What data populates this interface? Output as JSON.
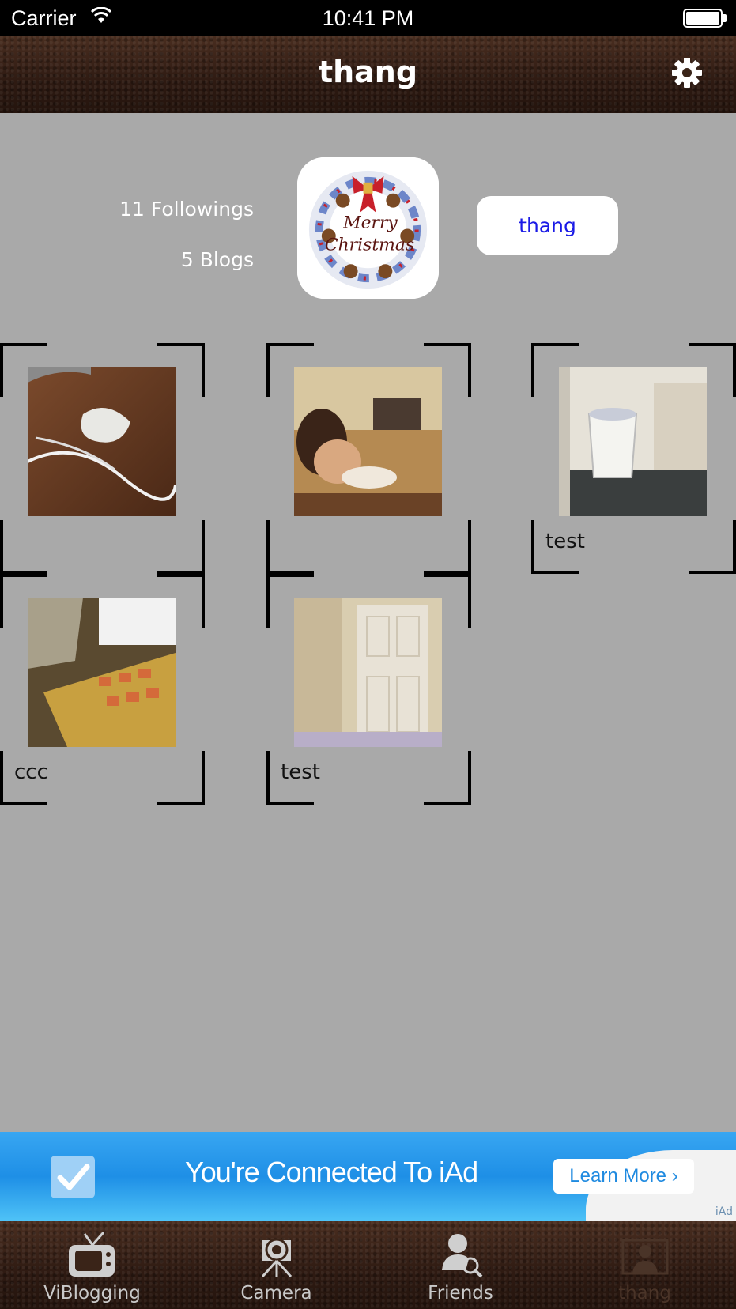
{
  "status_bar": {
    "carrier": "Carrier",
    "time": "10:41 PM"
  },
  "nav": {
    "title": "thang",
    "settings_icon": "gear-icon"
  },
  "profile": {
    "followings": "11 Followings",
    "blogs": "5 Blogs",
    "username_button": "thang",
    "avatar_image_text": "Merry Christmas"
  },
  "blogs": [
    {
      "caption": "",
      "thumb": "table-with-cables"
    },
    {
      "caption": "",
      "thumb": "person-cooking"
    },
    {
      "caption": "test",
      "thumb": "laundry-room"
    },
    {
      "caption": "ccc",
      "thumb": "laptop-keyboard"
    },
    {
      "caption": "test",
      "thumb": "white-door"
    }
  ],
  "ad": {
    "headline": "You're Connected To iAd",
    "button": "Learn More",
    "button_chevron": "›",
    "tag": "iAd"
  },
  "tabs": [
    {
      "label": "ViBlogging",
      "icon": "tv-icon",
      "active": false
    },
    {
      "label": "Camera",
      "icon": "camera-icon",
      "active": false
    },
    {
      "label": "Friends",
      "icon": "friends-search-icon",
      "active": false
    },
    {
      "label": "thang",
      "icon": "profile-icon",
      "active": true
    }
  ],
  "colors": {
    "background": "#a9a9a9",
    "username_text": "#1a1ae6",
    "ad_blue": "#1e8fe6"
  }
}
